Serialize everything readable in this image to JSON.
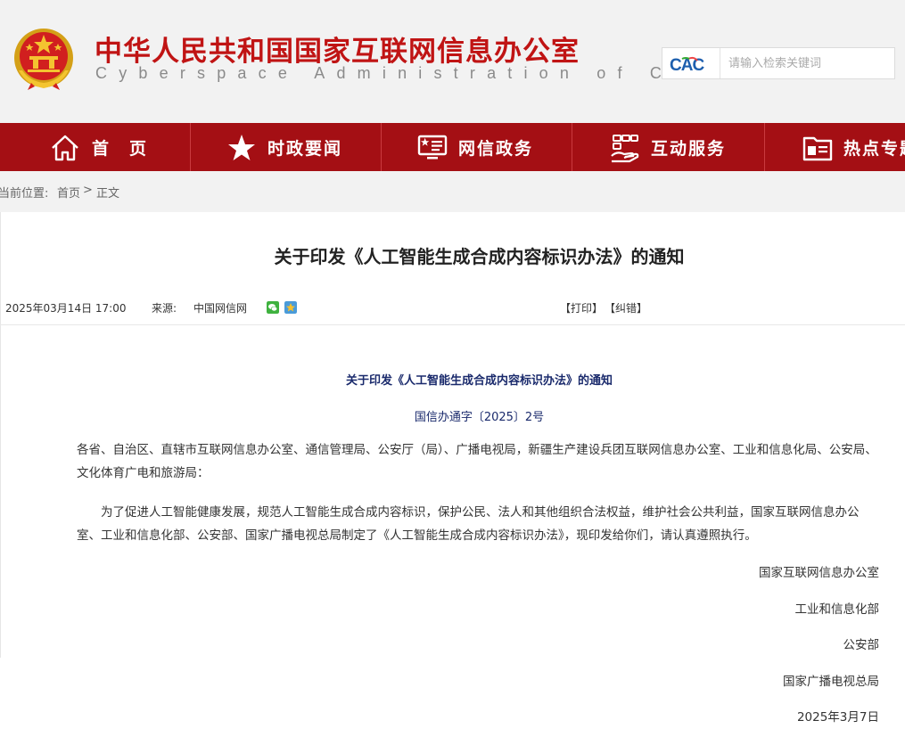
{
  "header": {
    "title": "中华人民共和国国家互联网信息办公室",
    "subtitle": "Cyberspace Administration of China",
    "search_placeholder": "请输入检索关键词",
    "cac_logo_text": "CAC"
  },
  "nav": {
    "items": [
      {
        "label": "首　页",
        "icon": "home-icon"
      },
      {
        "label": "时政要闻",
        "icon": "star-icon"
      },
      {
        "label": "网信政务",
        "icon": "monitor-icon"
      },
      {
        "label": "互动服务",
        "icon": "service-icon"
      },
      {
        "label": "热点专题",
        "icon": "folder-icon"
      }
    ]
  },
  "breadcrumb": {
    "prefix": "当前位置:",
    "home": "首页",
    "separator": ">",
    "current": "正文"
  },
  "article": {
    "title": "关于印发《人工智能生成合成内容标识办法》的通知",
    "date": "2025年03月14日 17:00",
    "source_label": "来源:",
    "source": "中国网信网",
    "print": "【打印】",
    "error": "【纠错】",
    "doc_heading": "关于印发《人工智能生成合成内容标识办法》的通知",
    "doc_number": "国信办通字〔2025〕2号",
    "recipients": "各省、自治区、直辖市互联网信息办公室、通信管理局、公安厅（局）、广播电视局，新疆生产建设兵团互联网信息办公室、工业和信息化局、公安局、文化体育广电和旅游局：",
    "body": "为了促进人工智能健康发展，规范人工智能生成合成内容标识，保护公民、法人和其他组织合法权益，维护社会公共利益，国家互联网信息办公室、工业和信息化部、公安部、国家广播电视总局制定了《人工智能生成合成内容标识办法》，现印发给你们，请认真遵照执行。",
    "signatories": [
      "国家互联网信息办公室",
      "工业和信息化部",
      "公安部",
      "国家广播电视总局"
    ],
    "sign_date": "2025年3月7日"
  },
  "colors": {
    "brand_red": "#c01414",
    "nav_bg": "#a40f14",
    "doc_blue": "#1a2a6c"
  }
}
